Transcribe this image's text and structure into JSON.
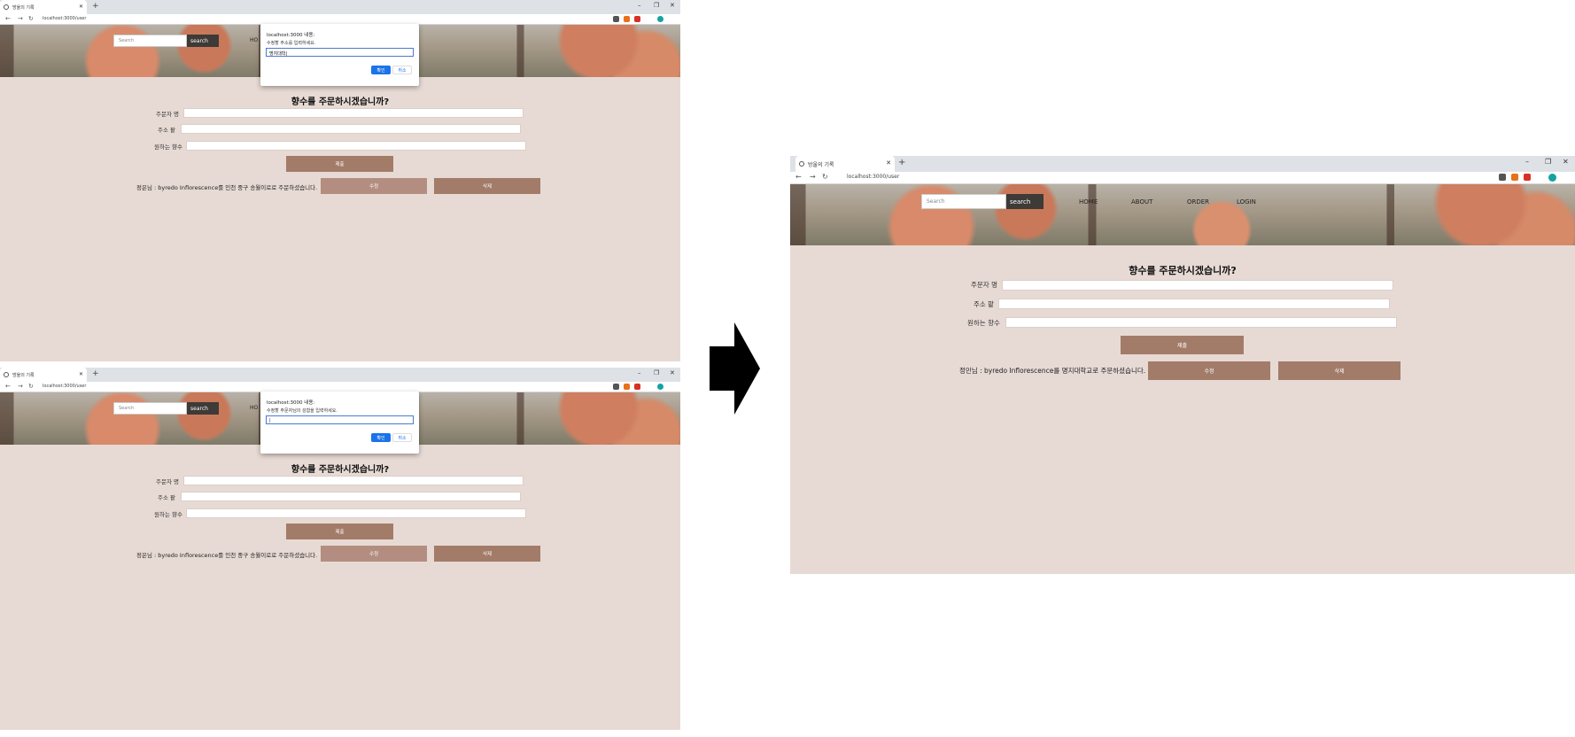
{
  "browser": {
    "tab_title": "방울의 기록",
    "url": "localhost:3000/user",
    "new_tab": "+",
    "win_controls": [
      "–",
      "❐",
      "✕"
    ],
    "nav_icons": [
      "←",
      "→",
      "↻"
    ]
  },
  "site": {
    "search_placeholder": "Search",
    "search_button": "search",
    "menu": [
      "HOME",
      "ABOUT",
      "ORDER",
      "LOGIN"
    ],
    "menu_partial": "HO",
    "heading": "향수를 주문하시겠습니까?",
    "fields": [
      {
        "label": "주문자 명"
      },
      {
        "label": "주소 팥"
      },
      {
        "label": "원하는 향수"
      }
    ],
    "submit": "제출",
    "edit": "수정",
    "delete": "삭제"
  },
  "screens": {
    "top_left": {
      "dialog_title": "localhost:3000 내용:",
      "dialog_message": "수정할 주소를 입력하세요.",
      "dialog_value": "명지대학|",
      "ok": "확인",
      "cancel": "취소",
      "order_line": "정은님 : byredo Inflorescence를 인천 중구 송월이로로 주문하셨습니다."
    },
    "bottom_left": {
      "dialog_title": "localhost:3000 내용:",
      "dialog_message": "수정할 주문자님의 성함을 입력하세요.",
      "dialog_value": "|",
      "ok": "확인",
      "cancel": "취소",
      "order_line": "정은님 : byredo Inflorescence를 인천 중구 송월이로로 주문하셨습니다."
    },
    "right": {
      "order_line": "정민님 : byredo Inflorescence를 명지대학교로 주문하셨습니다."
    }
  },
  "colors": {
    "page_bg": "#e7dad4",
    "button": "#a37b69",
    "arrow": "#000000",
    "dialog_ok": "#1a73e8"
  }
}
